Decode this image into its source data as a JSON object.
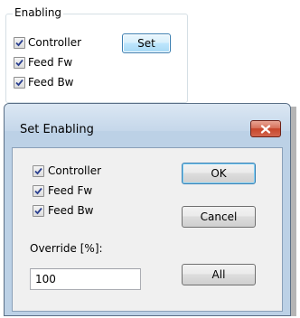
{
  "enabling_group": {
    "title": "Enabling",
    "checkboxes": [
      {
        "label": "Controller",
        "checked": true
      },
      {
        "label": "Feed Fw",
        "checked": true
      },
      {
        "label": "Feed Bw",
        "checked": true
      }
    ],
    "set_button_label": "Set"
  },
  "dialog": {
    "title": "Set Enabling",
    "close_icon": "close-icon",
    "checkboxes": [
      {
        "label": "Controller",
        "checked": true
      },
      {
        "label": "Feed Fw",
        "checked": true
      },
      {
        "label": "Feed Bw",
        "checked": true
      }
    ],
    "ok_label": "OK",
    "cancel_label": "Cancel",
    "override_label": "Override [%]:",
    "override_value": "100",
    "all_label": "All"
  },
  "colors": {
    "check_mark": "#2a3f8f",
    "close_button": "#c7452a",
    "focus_border": "#3c7fb1"
  }
}
